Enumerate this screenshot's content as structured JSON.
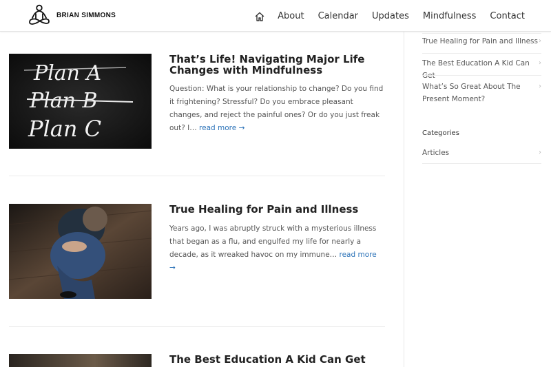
{
  "header": {
    "brand": "BRIAN SIMMONS",
    "nav": [
      "About",
      "Calendar",
      "Updates",
      "Mindfulness",
      "Contact"
    ]
  },
  "posts": [
    {
      "title": "That’s Life! Navigating Major Life Changes with Mindfulness",
      "excerpt": "Question: What is your relationship to change? Do you find it frightening?  Stressful? Do you embrace pleasant changes, and reject the painful ones? Or do you just freak out? I…",
      "more": "read more →",
      "image_text": [
        "Plan A",
        "Plan B",
        "Plan C"
      ]
    },
    {
      "title": "True Healing for Pain and Illness",
      "excerpt": "Years ago, I was abruptly struck with a mysterious illness that began as a flu, and engulfed my life for nearly a decade, as it wreaked havoc on my immune…",
      "more": "read more →"
    },
    {
      "title": "The Best Education A Kid Can Get"
    }
  ],
  "sidebar": {
    "recent": [
      "True Healing for Pain and Illness",
      "The Best Education A Kid Can Get",
      "What’s So Great About The Present Moment?"
    ],
    "categories_heading": "Categories",
    "categories": [
      "Articles"
    ]
  },
  "colors": {
    "link": "#2b72b8",
    "title": "#222222",
    "text": "#555555"
  }
}
